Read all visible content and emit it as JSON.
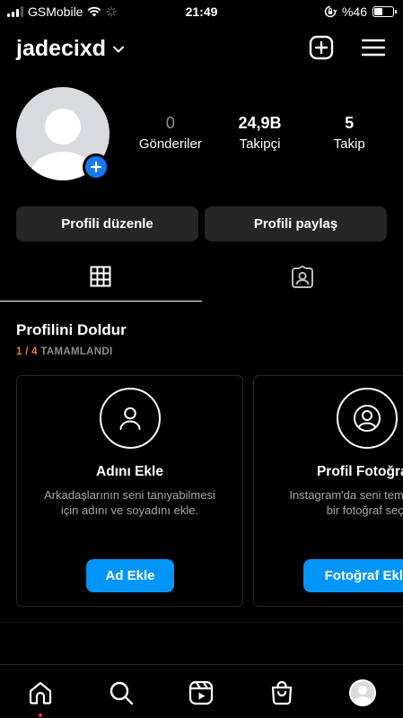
{
  "status_bar": {
    "carrier": "GSMobile",
    "time": "21:49",
    "battery_percent": "%46",
    "battery_level": 0.46
  },
  "header": {
    "username": "jadecixd"
  },
  "profile": {
    "stats": [
      {
        "value": "0",
        "label": "Gönderiler"
      },
      {
        "value": "24,9B",
        "label": "Takipçi"
      },
      {
        "value": "5",
        "label": "Takip"
      }
    ],
    "edit_button": "Profili düzenle",
    "share_button": "Profili paylaş"
  },
  "complete_profile": {
    "title": "Profilini Doldur",
    "progress_count": "1 / 4",
    "progress_label": "TAMAMLANDI",
    "cards": [
      {
        "title": "Adını Ekle",
        "desc_line1": "Arkadaşlarının seni tanıyabilmesi",
        "desc_line2": "için adını ve soyadını ekle.",
        "button": "Ad Ekle"
      },
      {
        "title": "Profil Fotoğrafı",
        "desc_line1": "Instagram'da seni temsil eden",
        "desc_line2": "bir fotoğraf seç.",
        "button": "Fotoğraf Ekle"
      }
    ]
  },
  "colors": {
    "accent_blue": "#0095f6",
    "badge_blue": "#1877f2",
    "progress_orange": "#ff7a18",
    "notification_red": "#ff3040"
  }
}
